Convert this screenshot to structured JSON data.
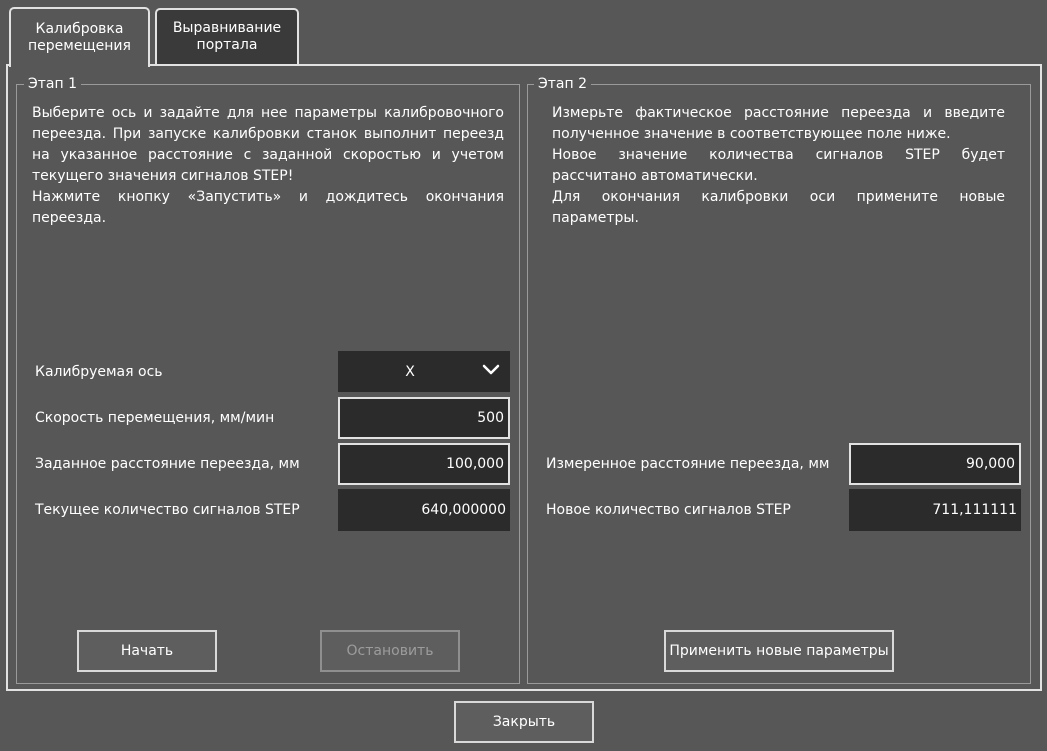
{
  "tabs": [
    {
      "label": "Калибровка\nперемещения",
      "active": true
    },
    {
      "label": "Выравнивание\nпортала",
      "active": false
    }
  ],
  "stage1": {
    "title": "Этап 1",
    "description": [
      "Выберите ось и задайте для нее параметры калибровочного переезда. При запуске калибровки станок выполнит переезд на указанное расстояние с заданной скоростью и учетом текущего значения сигналов STEP!",
      "Нажмите кнопку «Запустить» и дождитесь окончания переезда."
    ],
    "axis_label": "Калибруемая ось",
    "axis_value": "X",
    "speed_label": "Скорость перемещения, мм/мин",
    "speed_value": "500",
    "distance_label": "Заданное расстояние переезда, мм",
    "distance_value": "100,000",
    "steps_label": "Текущее количество сигналов STEP",
    "steps_value": "640,000000",
    "start_button": "Начать",
    "stop_button": "Остановить"
  },
  "stage2": {
    "title": "Этап 2",
    "description": [
      "Измерьте фактическое расстояние переезда и введите полученное значение в соответствующее поле ниже.",
      "Новое значение количества сигналов STEP будет рассчитано автоматически.",
      "Для окончания калибровки оси примените новые параметры."
    ],
    "measured_label": "Измеренное расстояние переезда, мм",
    "measured_value": "90,000",
    "new_steps_label": "Новое количество сигналов STEP",
    "new_steps_value": "711,111111",
    "apply_button": "Применить новые параметры"
  },
  "close_button": "Закрыть",
  "icons": {
    "axis_dropdown": "chevron-down-icon"
  }
}
